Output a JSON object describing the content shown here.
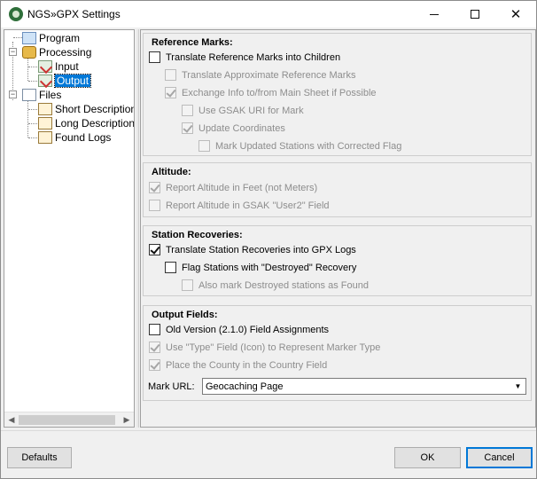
{
  "window": {
    "title": "NGS»GPX Settings",
    "minimize_glyph": "",
    "maximize_glyph": "",
    "close_glyph": "✕"
  },
  "tree": {
    "items": [
      {
        "label": "Program",
        "icon": "program-icon"
      },
      {
        "label": "Processing",
        "icon": "processing-icon"
      },
      {
        "label": "Input",
        "icon": "input-icon"
      },
      {
        "label": "Output",
        "icon": "output-icon",
        "selected": true
      },
      {
        "label": "Files",
        "icon": "files-icon"
      },
      {
        "label": "Short Description",
        "icon": "document-icon"
      },
      {
        "label": "Long Description",
        "icon": "document-icon"
      },
      {
        "label": "Found Logs",
        "icon": "document-icon"
      }
    ],
    "expander_glyph": "−",
    "scroll_left": "◀",
    "scroll_right": "▶"
  },
  "reference_marks": {
    "title": "Reference Marks:",
    "translate_children": {
      "label": "Translate Reference Marks into Children",
      "checked": false,
      "enabled": true
    },
    "translate_approx": {
      "label": "Translate Approximate Reference Marks",
      "checked": false,
      "enabled": false
    },
    "exchange_info": {
      "label": "Exchange Info to/from Main Sheet if Possible",
      "checked": true,
      "enabled": false
    },
    "use_gsak_uri": {
      "label": "Use GSAK URI for Mark",
      "checked": false,
      "enabled": false
    },
    "update_coords": {
      "label": "Update Coordinates",
      "checked": true,
      "enabled": false
    },
    "mark_updated": {
      "label": "Mark Updated Stations with Corrected Flag",
      "checked": false,
      "enabled": false
    }
  },
  "altitude": {
    "title": "Altitude:",
    "feet": {
      "label": "Report Altitude in Feet (not Meters)",
      "checked": true,
      "enabled": false
    },
    "user2": {
      "label": "Report Altitude in GSAK \"User2\" Field",
      "checked": false,
      "enabled": false
    }
  },
  "station_recoveries": {
    "title": "Station Recoveries:",
    "translate": {
      "label": "Translate Station Recoveries into GPX Logs",
      "checked": true,
      "enabled": true
    },
    "flag_destroyed": {
      "label": "Flag Stations with \"Destroyed\" Recovery",
      "checked": false,
      "enabled": true
    },
    "mark_found": {
      "label": "Also mark Destroyed stations as Found",
      "checked": false,
      "enabled": false
    }
  },
  "output_fields": {
    "title": "Output Fields:",
    "old_version": {
      "label": "Old Version (2.1.0) Field Assignments",
      "checked": false,
      "enabled": true
    },
    "use_type": {
      "label": "Use \"Type\" Field (Icon) to Represent Marker Type",
      "checked": true,
      "enabled": false
    },
    "county": {
      "label": "Place the County in the Country Field",
      "checked": true,
      "enabled": false
    },
    "mark_url_label": "Mark URL:",
    "mark_url_value": "Geocaching Page",
    "dropdown_glyph": "▼"
  },
  "buttons": {
    "defaults": "Defaults",
    "ok": "OK",
    "cancel": "Cancel"
  }
}
